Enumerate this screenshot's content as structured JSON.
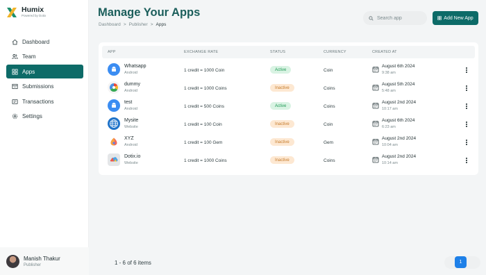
{
  "brand": {
    "name": "Humix",
    "tagline": "Powered by Dotix"
  },
  "sidebar": {
    "items": [
      {
        "label": "Dashboard"
      },
      {
        "label": "Team"
      },
      {
        "label": "Apps"
      },
      {
        "label": "Submissions"
      },
      {
        "label": "Transactions"
      },
      {
        "label": "Settings"
      }
    ],
    "active": "Apps"
  },
  "user": {
    "name": "Manish Thakur",
    "role": "Publisher"
  },
  "header": {
    "title": "Manage Your Apps",
    "breadcrumb": [
      "Dashboard",
      "Publisher",
      "Apps"
    ],
    "search_placeholder": "Search app",
    "add_button": "Add New App"
  },
  "table": {
    "columns": [
      "APP",
      "EXCHANGE RATE",
      "STATUS",
      "CURRENCY",
      "CREATED AT"
    ],
    "rows": [
      {
        "name": "Whatsapp",
        "platform": "Android",
        "rate": "1 credit = 1000 Coin",
        "status": "Active",
        "currency": "Coin",
        "date": "August 6th 2024",
        "time": "9:38 am",
        "icon": "android-icon"
      },
      {
        "name": "dummy",
        "platform": "Android",
        "rate": "1 credit = 1000 Coins",
        "status": "Inactive",
        "currency": "Coins",
        "date": "August 5th 2024",
        "time": "5:48 am",
        "icon": "app-logo-icon"
      },
      {
        "name": "test",
        "platform": "Android",
        "rate": "1 credit = 500 Coins",
        "status": "Active",
        "currency": "Coins",
        "date": "August 2nd 2024",
        "time": "10:17 am",
        "icon": "android-icon"
      },
      {
        "name": "Mysite",
        "platform": "Website",
        "rate": "1 credit = 100 Coin",
        "status": "Inactive",
        "currency": "Coin",
        "date": "August 6th 2024",
        "time": "6:23 am",
        "icon": "globe-icon"
      },
      {
        "name": "XYZ",
        "platform": "Android",
        "rate": "1 credit = 100 Gem",
        "status": "Inactive",
        "currency": "Gem",
        "date": "August 2nd 2024",
        "time": "10:04 am",
        "icon": "app-logo-icon"
      },
      {
        "name": "Dotix.io",
        "platform": "Website",
        "rate": "1 credit = 1000 Coins",
        "status": "Inactive",
        "currency": "Coins",
        "date": "August 2nd 2024",
        "time": "10:14 am",
        "icon": "app-logo-icon"
      }
    ]
  },
  "pagination": {
    "summary": "1 - 6 of 6 items",
    "current_page": "1"
  },
  "colors": {
    "primary": "#0d6b68",
    "active_badge": "#1f9a55",
    "inactive_badge": "#c57b2b",
    "page_button": "#1e80e8"
  }
}
